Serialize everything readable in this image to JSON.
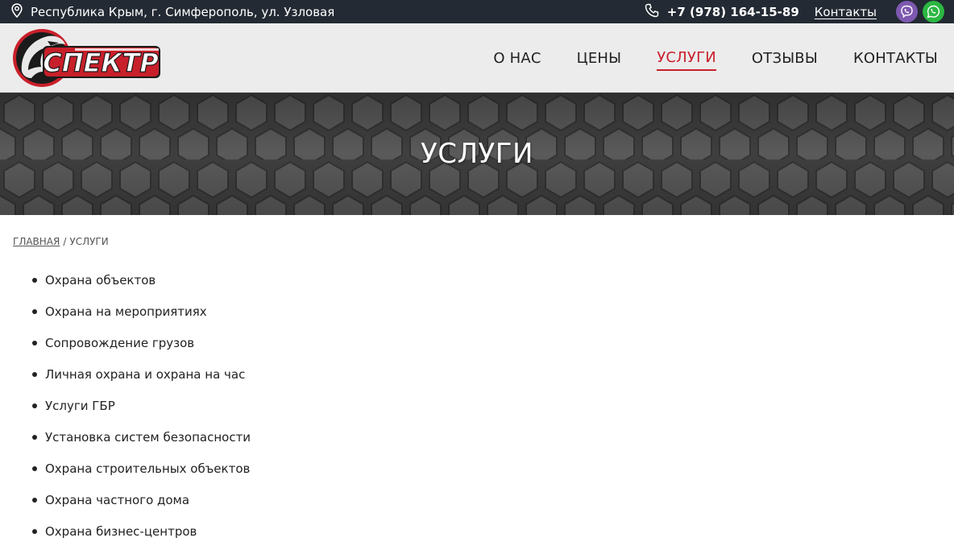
{
  "topbar": {
    "address": "Республика Крым, г. Симферополь, ул. Узловая",
    "phone": "+7 (978) 164-15-89",
    "contacts_link": "Контакты"
  },
  "header": {
    "logo_text": "СПЕКТР",
    "nav": [
      {
        "label": "О НАС",
        "active": false
      },
      {
        "label": "ЦЕНЫ",
        "active": false
      },
      {
        "label": "УСЛУГИ",
        "active": true
      },
      {
        "label": "ОТЗЫВЫ",
        "active": false
      },
      {
        "label": "КОНТАКТЫ",
        "active": false
      }
    ]
  },
  "banner": {
    "title": "УСЛУГИ"
  },
  "breadcrumb": {
    "home": "ГЛАВНАЯ",
    "separator": "/",
    "current": "УСЛУГИ"
  },
  "services": [
    "Охрана объектов",
    "Охрана на мероприятиях",
    "Сопровождение грузов",
    "Личная охрана и охрана на час",
    "Услуги ГБР",
    "Установка систем безопасности",
    "Охрана строительных объектов",
    "Охрана частного дома",
    "Охрана бизнес-центров"
  ],
  "colors": {
    "topbar_bg": "#232a33",
    "accent": "#c8202a",
    "viber": "#7d59b0",
    "whatsapp": "#2bb741"
  },
  "icons": {
    "address": "location-pin-icon",
    "phone": "phone-icon",
    "viber": "viber-icon",
    "whatsapp": "whatsapp-icon"
  }
}
